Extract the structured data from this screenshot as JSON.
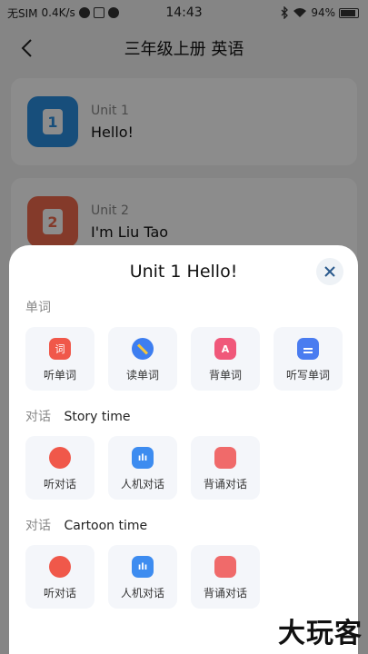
{
  "status_bar": {
    "carrier": "无SIM",
    "speed": "0.4K/s",
    "time": "14:43",
    "battery": "94%"
  },
  "nav": {
    "title": "三年级上册 英语"
  },
  "units": [
    {
      "no": "Unit 1",
      "name": "Hello!",
      "icon_text": "1",
      "color": "#2b8fe0"
    },
    {
      "no": "Unit 2",
      "name": "I'm Liu Tao",
      "icon_text": "2",
      "color": "#f06b4e"
    }
  ],
  "sheet": {
    "title": "Unit 1 Hello!",
    "sections": [
      {
        "category": "单词",
        "name": "",
        "items": [
          {
            "label": "听单词",
            "icon": "listen-words-icon",
            "color": "#f0584a"
          },
          {
            "label": "读单词",
            "icon": "read-words-icon",
            "color": "#3d7ef0"
          },
          {
            "label": "背单词",
            "icon": "memorize-words-icon",
            "color": "#f0587a"
          },
          {
            "label": "听写单词",
            "icon": "dictation-icon",
            "color": "#4a7cf0"
          }
        ]
      },
      {
        "category": "对话",
        "name": "Story time",
        "items": [
          {
            "label": "听对话",
            "icon": "listen-dialogue-icon",
            "color": "#f0584a"
          },
          {
            "label": "人机对话",
            "icon": "ai-dialogue-icon",
            "color": "#3d8cf0"
          },
          {
            "label": "背诵对话",
            "icon": "recite-dialogue-icon",
            "color": "#f06a6a"
          }
        ]
      },
      {
        "category": "对话",
        "name": "Cartoon time",
        "items": [
          {
            "label": "听对话",
            "icon": "listen-dialogue-icon",
            "color": "#f0584a"
          },
          {
            "label": "人机对话",
            "icon": "ai-dialogue-icon",
            "color": "#3d8cf0"
          },
          {
            "label": "背诵对话",
            "icon": "recite-dialogue-icon",
            "color": "#f06a6a"
          }
        ]
      }
    ]
  },
  "watermark": "大玩客"
}
